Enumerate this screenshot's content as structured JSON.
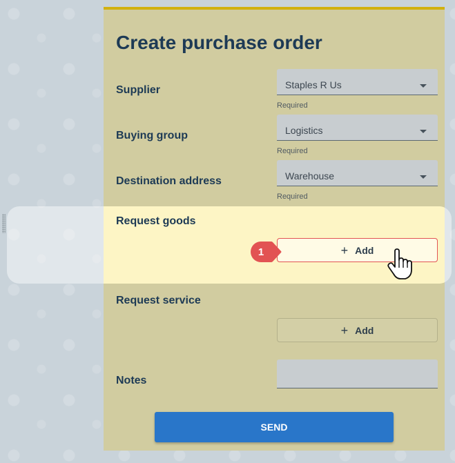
{
  "form": {
    "title": "Create purchase order",
    "supplier": {
      "label": "Supplier",
      "value": "Staples R Us",
      "helper": "Required"
    },
    "buying_group": {
      "label": "Buying group",
      "value": "Logistics",
      "helper": "Required"
    },
    "destination": {
      "label": "Destination address",
      "value": "Warehouse",
      "helper": "Required"
    },
    "request_goods": {
      "label": "Request goods",
      "add_label": "Add"
    },
    "request_service": {
      "label": "Request service",
      "add_label": "Add"
    },
    "notes": {
      "label": "Notes",
      "value": ""
    },
    "send_label": "SEND"
  },
  "tutorial": {
    "step_number": "1"
  },
  "colors": {
    "card": "#d1cca0",
    "card_top_border": "#d2b10f",
    "highlight": "#fdf5c5",
    "accent_red": "#e25353",
    "send_button": "#2976c9",
    "heading_text": "#1d3a55"
  },
  "icons": {
    "select_caret": "caret-down-icon",
    "add": "plus-icon",
    "cursor": "hand-pointer-icon"
  }
}
